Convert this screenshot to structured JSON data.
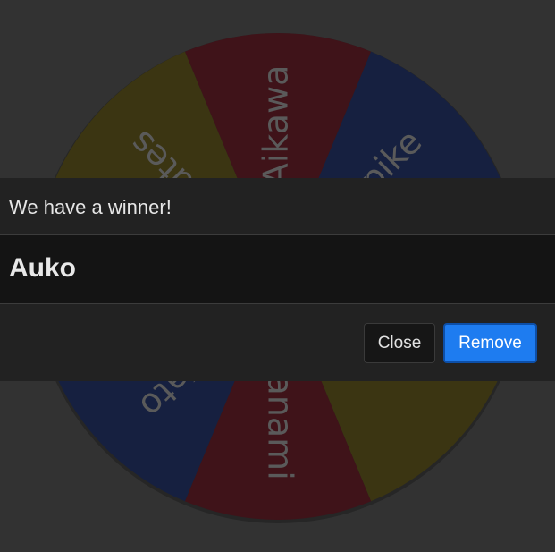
{
  "wheel": {
    "segments": [
      {
        "label": "Aikawa",
        "color": "#3f1319"
      },
      {
        "label": "Spike",
        "color": "#162040"
      },
      {
        "label": "",
        "color": "#123a18"
      },
      {
        "label": "",
        "color": "#3b3512"
      },
      {
        "label": "anami",
        "color": "#3f1319"
      },
      {
        "label": "Kato",
        "color": "#162040"
      },
      {
        "label": "",
        "color": "#123a18"
      },
      {
        "label": "Itutes",
        "color": "#3b3512"
      }
    ]
  },
  "modal": {
    "title": "We have a winner!",
    "winner": "Auko",
    "close_label": "Close",
    "remove_label": "Remove"
  },
  "colors": {
    "accent": "#1e7cf0",
    "modal_bg": "#222222",
    "body_bg": "#141414"
  }
}
